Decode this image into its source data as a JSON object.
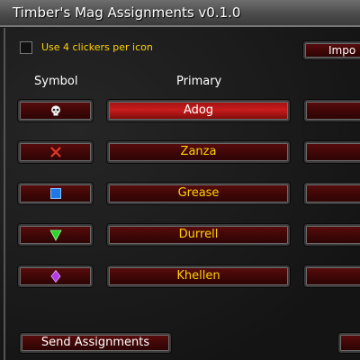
{
  "window": {
    "title": "Timber's Mag Assignments v0.1.0"
  },
  "options": {
    "use_four_clickers_label": "Use 4 clickers per icon"
  },
  "import_button_label": "Impo",
  "columns": {
    "symbol": "Symbol",
    "primary": "Primary"
  },
  "rows": [
    {
      "symbol_icon": "skull-icon",
      "primary": "Adog",
      "active": true
    },
    {
      "symbol_icon": "cross-icon",
      "primary": "Zanza",
      "active": false
    },
    {
      "symbol_icon": "square-icon",
      "primary": "Grease",
      "active": false
    },
    {
      "symbol_icon": "triangle-icon",
      "primary": "Durrell",
      "active": false
    },
    {
      "symbol_icon": "diamond-icon",
      "primary": "Khellen",
      "active": false
    }
  ],
  "send_button_label": "Send Assignments",
  "colors": {
    "button_text": "#ffd200",
    "button_bg": "#4a0808",
    "active_button_bg": "#c01818"
  }
}
